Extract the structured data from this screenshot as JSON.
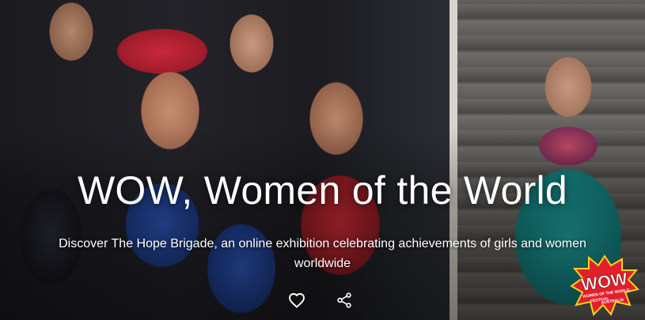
{
  "hero": {
    "title": "WOW, Women of the World",
    "subtitle": "Discover The Hope Brigade, an online exhibition celebrating achievements of girls and women worldwide"
  },
  "actions": [
    {
      "icon": "heart-outline-icon"
    },
    {
      "icon": "share-icon"
    }
  ],
  "logo": {
    "wordmark": "WOW",
    "line1": "WOMEN OF THE WORLD",
    "line2": "FESTIVAL",
    "line3": "AUSTRALIA"
  },
  "colors": {
    "text": "#ffffff",
    "logo_red": "#e0202a",
    "logo_yellow": "#f6d21a"
  }
}
